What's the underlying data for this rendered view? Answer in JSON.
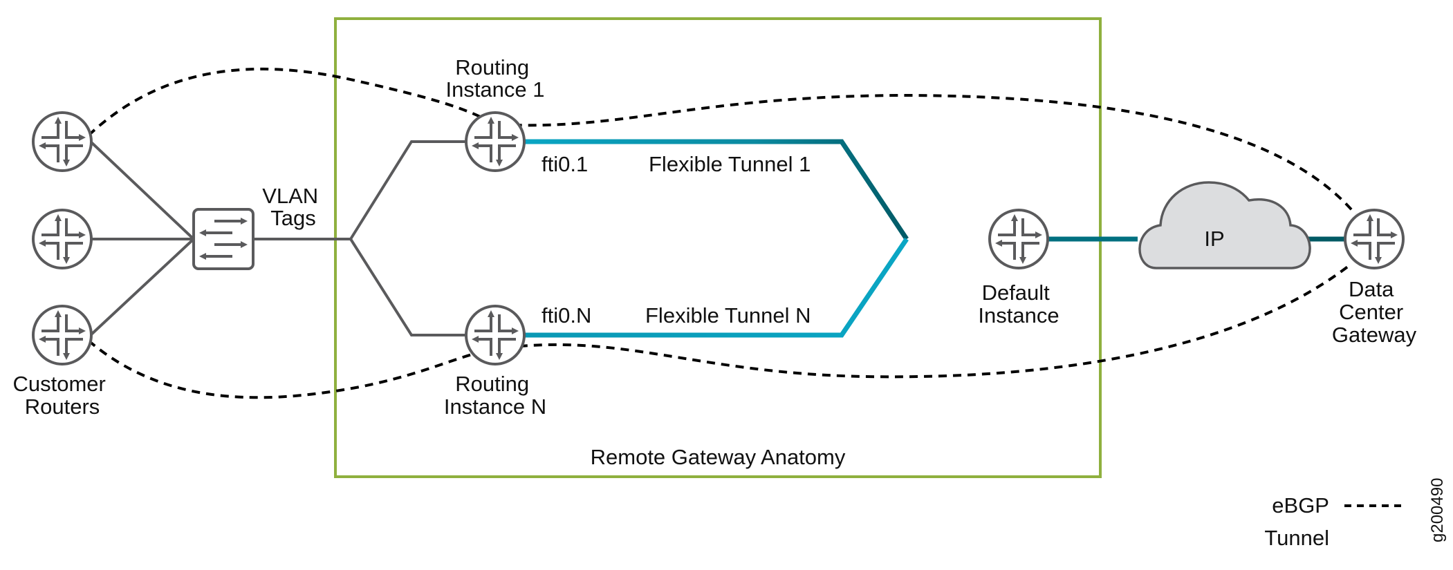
{
  "diagram": {
    "box_label": "Remote Gateway Anatomy",
    "nodes": {
      "customer_routers": [
        "Customer",
        "Routers"
      ],
      "vlan_tags": [
        "VLAN",
        "Tags"
      ],
      "routing_instance_1": [
        "Routing",
        "Instance 1"
      ],
      "routing_instance_n": [
        "Routing",
        "Instance N"
      ],
      "default_instance": [
        "Default",
        "Instance"
      ],
      "cloud": "IP",
      "data_center_gateway": [
        "Data",
        "Center",
        "Gateway"
      ]
    },
    "interfaces": {
      "fti1": "fti0.1",
      "ftin": "fti0.N"
    },
    "tunnels": {
      "t1": "Flexible Tunnel 1",
      "tn": "Flexible Tunnel N"
    },
    "legend": {
      "ebgp": "eBGP",
      "tunnel": "Tunnel"
    },
    "figure_id": "g200490",
    "colors": {
      "box": "#8fb03e",
      "device": "#5a5a5c",
      "tunnel_light": "#0aa0c0",
      "tunnel_dark": "#005560",
      "ebgp": "#000000",
      "cloud_fill": "#dcdddf"
    }
  }
}
